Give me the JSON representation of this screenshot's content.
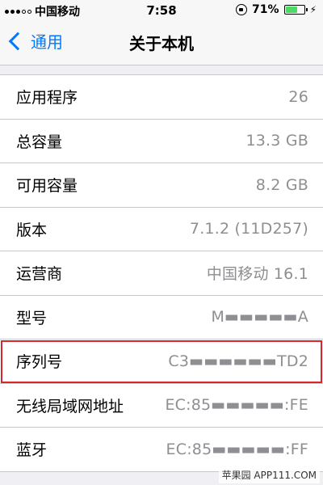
{
  "status_bar": {
    "carrier": "中国移动",
    "time": "7:58",
    "battery_percent_label": "71%",
    "battery_level": 0.71,
    "accent_green": "#4cd964"
  },
  "nav": {
    "back_label": "通用",
    "title": "关于本机",
    "accent_color": "#007aff"
  },
  "rows": [
    {
      "label": "应用程序",
      "value": "26"
    },
    {
      "label": "总容量",
      "value": "13.3 GB"
    },
    {
      "label": "可用容量",
      "value": "8.2 GB"
    },
    {
      "label": "版本",
      "value": "7.1.2 (11D257)"
    },
    {
      "label": "运营商",
      "value": "中国移动 16.1"
    },
    {
      "label": "型号",
      "value": "M▬▬▬▬▬A"
    },
    {
      "label": "序列号",
      "value": "C3▬▬▬▬▬▬TD2"
    },
    {
      "label": "无线局域网地址",
      "value": "EC:85▬▬▬▬▬:FE"
    },
    {
      "label": "蓝牙",
      "value": "EC:85▬▬▬▬▬:FF"
    }
  ],
  "highlight_color": "#d9262c",
  "watermark": "苹果园 APP111.COM"
}
